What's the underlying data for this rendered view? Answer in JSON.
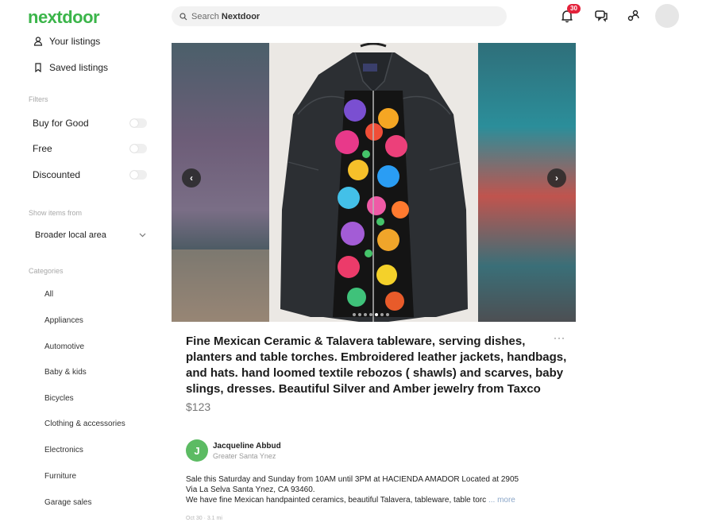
{
  "app": {
    "logo": "nextdoor"
  },
  "search": {
    "prefix": "Search",
    "brand": "Nextdoor"
  },
  "topbar": {
    "notification_count": "30"
  },
  "sidebar": {
    "your_listings": "Your listings",
    "saved_listings": "Saved listings",
    "filters_heading": "Filters",
    "filters": [
      "Buy for Good",
      "Free",
      "Discounted"
    ],
    "show_items_heading": "Show items from",
    "area_select": "Broader local area",
    "categories_heading": "Categories",
    "categories": [
      "All",
      "Appliances",
      "Automotive",
      "Baby & kids",
      "Bicycles",
      "Clothing & accessories",
      "Electronics",
      "Furniture",
      "Garage sales"
    ]
  },
  "listing": {
    "title": "Fine Mexican Ceramic & Talavera tableware, serving dishes, planters and table torches. Embroidered leather jackets, handbags, and hats. hand loomed textile rebozos ( shawls) and scarves, baby slings, dresses. Beautiful Silver and Amber jewelry from Taxco",
    "price": "$123",
    "image_count": 7,
    "current_image": 4,
    "seller": {
      "initial": "J",
      "name": "Jacqueline Abbud",
      "location": "Greater Santa Ynez"
    },
    "description_lines": [
      "Sale this Saturday and Sunday from 10AM until 3PM at HACIENDA AMADOR Located at 2905",
      "Via La Selva Santa Ynez, CA 93460.",
      "We have fine Mexican handpainted ceramics, beautiful Talavera, tableware, table torc"
    ],
    "more_label": "... more",
    "timestamp": "Oct 30 · 3.1 mi"
  },
  "colors": {
    "brand": "#3bb54a",
    "badge": "#e4223b",
    "seller_avatar": "#5cbb63"
  }
}
